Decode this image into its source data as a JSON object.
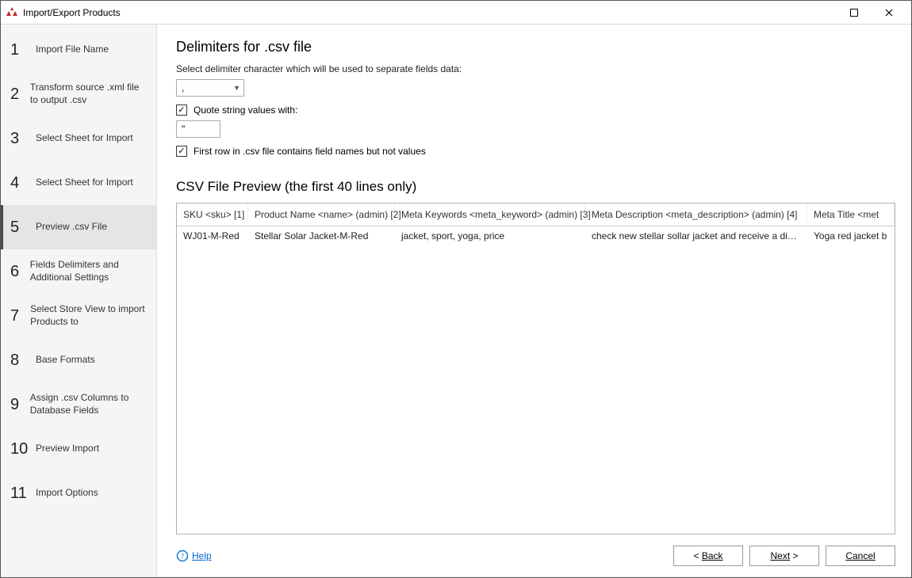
{
  "window": {
    "title": "Import/Export Products"
  },
  "sidebar": {
    "steps": [
      {
        "n": "1",
        "label": "Import File Name"
      },
      {
        "n": "2",
        "label": "Transform source .xml file to output .csv"
      },
      {
        "n": "3",
        "label": "Select Sheet for Import"
      },
      {
        "n": "4",
        "label": "Select Sheet for Import"
      },
      {
        "n": "5",
        "label": "Preview .csv File"
      },
      {
        "n": "6",
        "label": "Fields Delimiters and Additional Settings"
      },
      {
        "n": "7",
        "label": "Select Store View to import Products to"
      },
      {
        "n": "8",
        "label": "Base Formats"
      },
      {
        "n": "9",
        "label": "Assign .csv Columns to Database Fields"
      },
      {
        "n": "10",
        "label": "Preview Import"
      },
      {
        "n": "11",
        "label": "Import Options"
      }
    ],
    "active_index": 4
  },
  "content": {
    "delimiters_title": "Delimiters for .csv file",
    "delimiter_hint": "Select delimiter character which will be used to separate fields data:",
    "delimiter_value": ",",
    "quote_checkbox_checked": true,
    "quote_label": "Quote string values with:",
    "quote_value": "\"",
    "firstrow_checkbox_checked": true,
    "firstrow_label": "First row in .csv file contains field names but not values",
    "preview_title": "CSV File Preview (the first 40 lines only)",
    "columns": [
      "SKU <sku> [1]",
      "Product Name <name> (admin) [2]",
      "Meta Keywords <meta_keyword> (admin) [3]",
      "Meta Description <meta_description> (admin) [4]",
      "Meta Title <met"
    ],
    "rows": [
      {
        "c1": "WJ01-M-Red",
        "c2": "Stellar Solar Jacket-M-Red",
        "c3": "jacket, sport, yoga, price",
        "c4": "check new stellar sollar jacket and receive a discount…",
        "c5": "Yoga red jacket b"
      }
    ]
  },
  "footer": {
    "help": "Help",
    "back": "Back",
    "next": "Next",
    "cancel": "Cancel"
  }
}
